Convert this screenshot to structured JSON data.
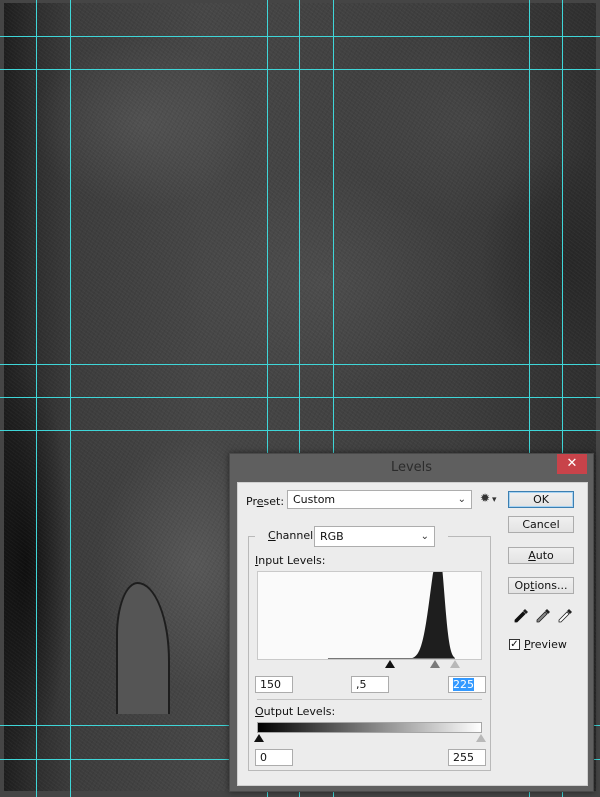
{
  "canvas": {
    "guide_color": "#3fd6d8",
    "background_description": "dark grunge paper texture"
  },
  "dialog": {
    "title": "Levels",
    "close_glyph": "✕",
    "close_color": "#c8434a",
    "preset": {
      "label_prefix": "Pr",
      "label_underlined": "e",
      "label_suffix": "set:",
      "value": "Custom",
      "options_icon": "gear-icon"
    },
    "channel": {
      "label_underlined": "C",
      "label_suffix": "hannel:",
      "value": "RGB"
    },
    "input_levels": {
      "label_underlined": "I",
      "label_suffix": "nput Levels:",
      "black": "150",
      "gamma": ",5",
      "white": "225",
      "white_selected": true
    },
    "histogram": {
      "peak_level": 207,
      "spread_low": 150,
      "spread_high": 225,
      "color": "#1e1e1e"
    },
    "output_levels": {
      "label_underlined": "O",
      "label_suffix": "utput Levels:",
      "black": "0",
      "white": "255"
    },
    "buttons": {
      "ok": "OK",
      "cancel": "Cancel",
      "auto_underlined": "A",
      "auto_suffix": "uto",
      "options_prefix": "Op",
      "options_underlined": "t",
      "options_suffix": "ions..."
    },
    "eyedroppers": [
      "black-point-eyedropper-icon",
      "gray-point-eyedropper-icon",
      "white-point-eyedropper-icon"
    ],
    "preview": {
      "label_underlined": "P",
      "label_suffix": "review",
      "checked": true,
      "check_glyph": "✓"
    }
  }
}
